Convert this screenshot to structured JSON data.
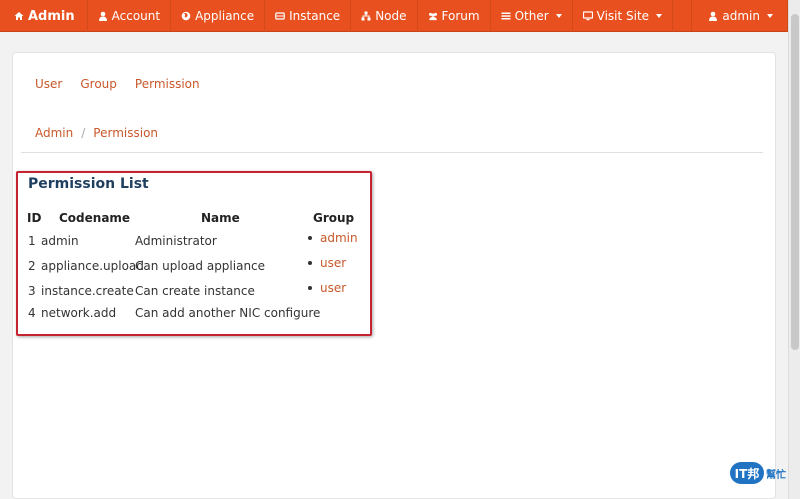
{
  "navbar": {
    "brand": "Admin",
    "items": [
      {
        "label": "Account",
        "icon": "user-icon"
      },
      {
        "label": "Appliance",
        "icon": "globe-icon"
      },
      {
        "label": "Instance",
        "icon": "server-icon"
      },
      {
        "label": "Node",
        "icon": "sitemap-icon"
      },
      {
        "label": "Forum",
        "icon": "users-icon"
      },
      {
        "label": "Other",
        "icon": "bars-icon"
      },
      {
        "label": "Visit Site",
        "icon": "monitor-icon"
      }
    ],
    "user": "admin",
    "color": "#e8511f"
  },
  "subnav": [
    "User",
    "Group",
    "Permission"
  ],
  "breadcrumb": {
    "root": "Admin",
    "separator": "/",
    "current": "Permission"
  },
  "permission": {
    "title": "Permission List",
    "headers": {
      "id": "ID",
      "codename": "Codename",
      "name": "Name",
      "group": "Group"
    },
    "rows": [
      {
        "id": "1",
        "codename": "admin",
        "name": "Administrator",
        "group": "admin"
      },
      {
        "id": "2",
        "codename": "appliance.upload",
        "name": "Can upload appliance",
        "group": "user"
      },
      {
        "id": "3",
        "codename": "instance.create",
        "name": "Can create instance",
        "group": "user"
      },
      {
        "id": "4",
        "codename": "network.add",
        "name": "Can add another NIC configure",
        "group": ""
      }
    ]
  },
  "watermark": {
    "logo": "IT邦",
    "text": "幫忙"
  }
}
